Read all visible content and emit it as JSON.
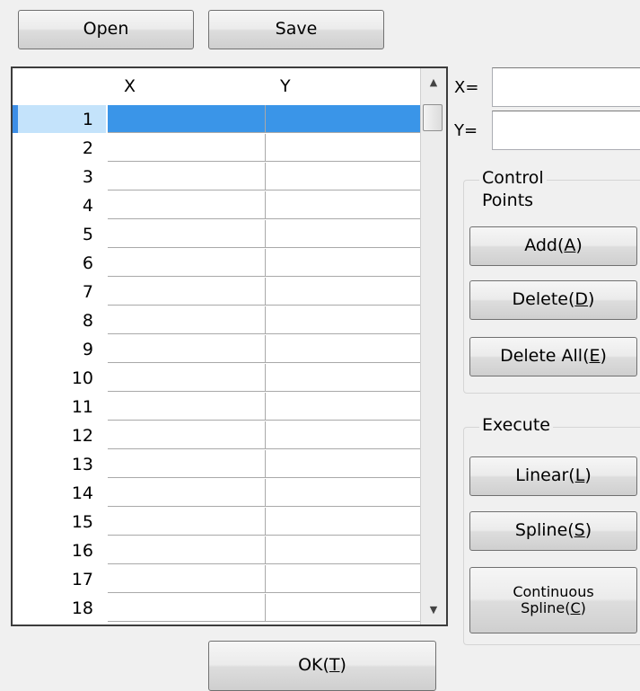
{
  "toolbar": {
    "open_label": "Open",
    "save_label": "Save"
  },
  "grid": {
    "columns": {
      "x": "X",
      "y": "Y"
    },
    "rows": [
      "1",
      "2",
      "3",
      "4",
      "5",
      "6",
      "7",
      "8",
      "9",
      "10",
      "11",
      "12",
      "13",
      "14",
      "15",
      "16",
      "17",
      "18"
    ],
    "selected_row": "1",
    "values": []
  },
  "scrollbar": {
    "up_arrow": "▲",
    "down_arrow": "▼"
  },
  "coords": {
    "x_label": "X=",
    "y_label": "Y=",
    "x_value": "",
    "y_value": ""
  },
  "control_points": {
    "title_line1": "Control",
    "title_line2": "Points",
    "add_label": "Add(",
    "add_key": "A",
    "add_end": ")",
    "delete_label": "Delete(",
    "delete_key": "D",
    "delete_end": ")",
    "delete_all_label": "Delete All(",
    "delete_all_key": "E",
    "delete_all_end": ")"
  },
  "execute": {
    "title": "Execute",
    "linear_label": "Linear(",
    "linear_key": "L",
    "linear_end": ")",
    "spline_label": "Spline(",
    "spline_key": "S",
    "spline_end": ")",
    "continuous_line1": "Continuous",
    "continuous_label": "Spline(",
    "continuous_key": "C",
    "continuous_end": ")"
  },
  "footer": {
    "ok_label": "OK(",
    "ok_key": "T",
    "ok_end": ")"
  },
  "colors": {
    "selection": "#3a95e8",
    "row_header_selected": "#c4e3fb",
    "background": "#f0f0f0"
  }
}
